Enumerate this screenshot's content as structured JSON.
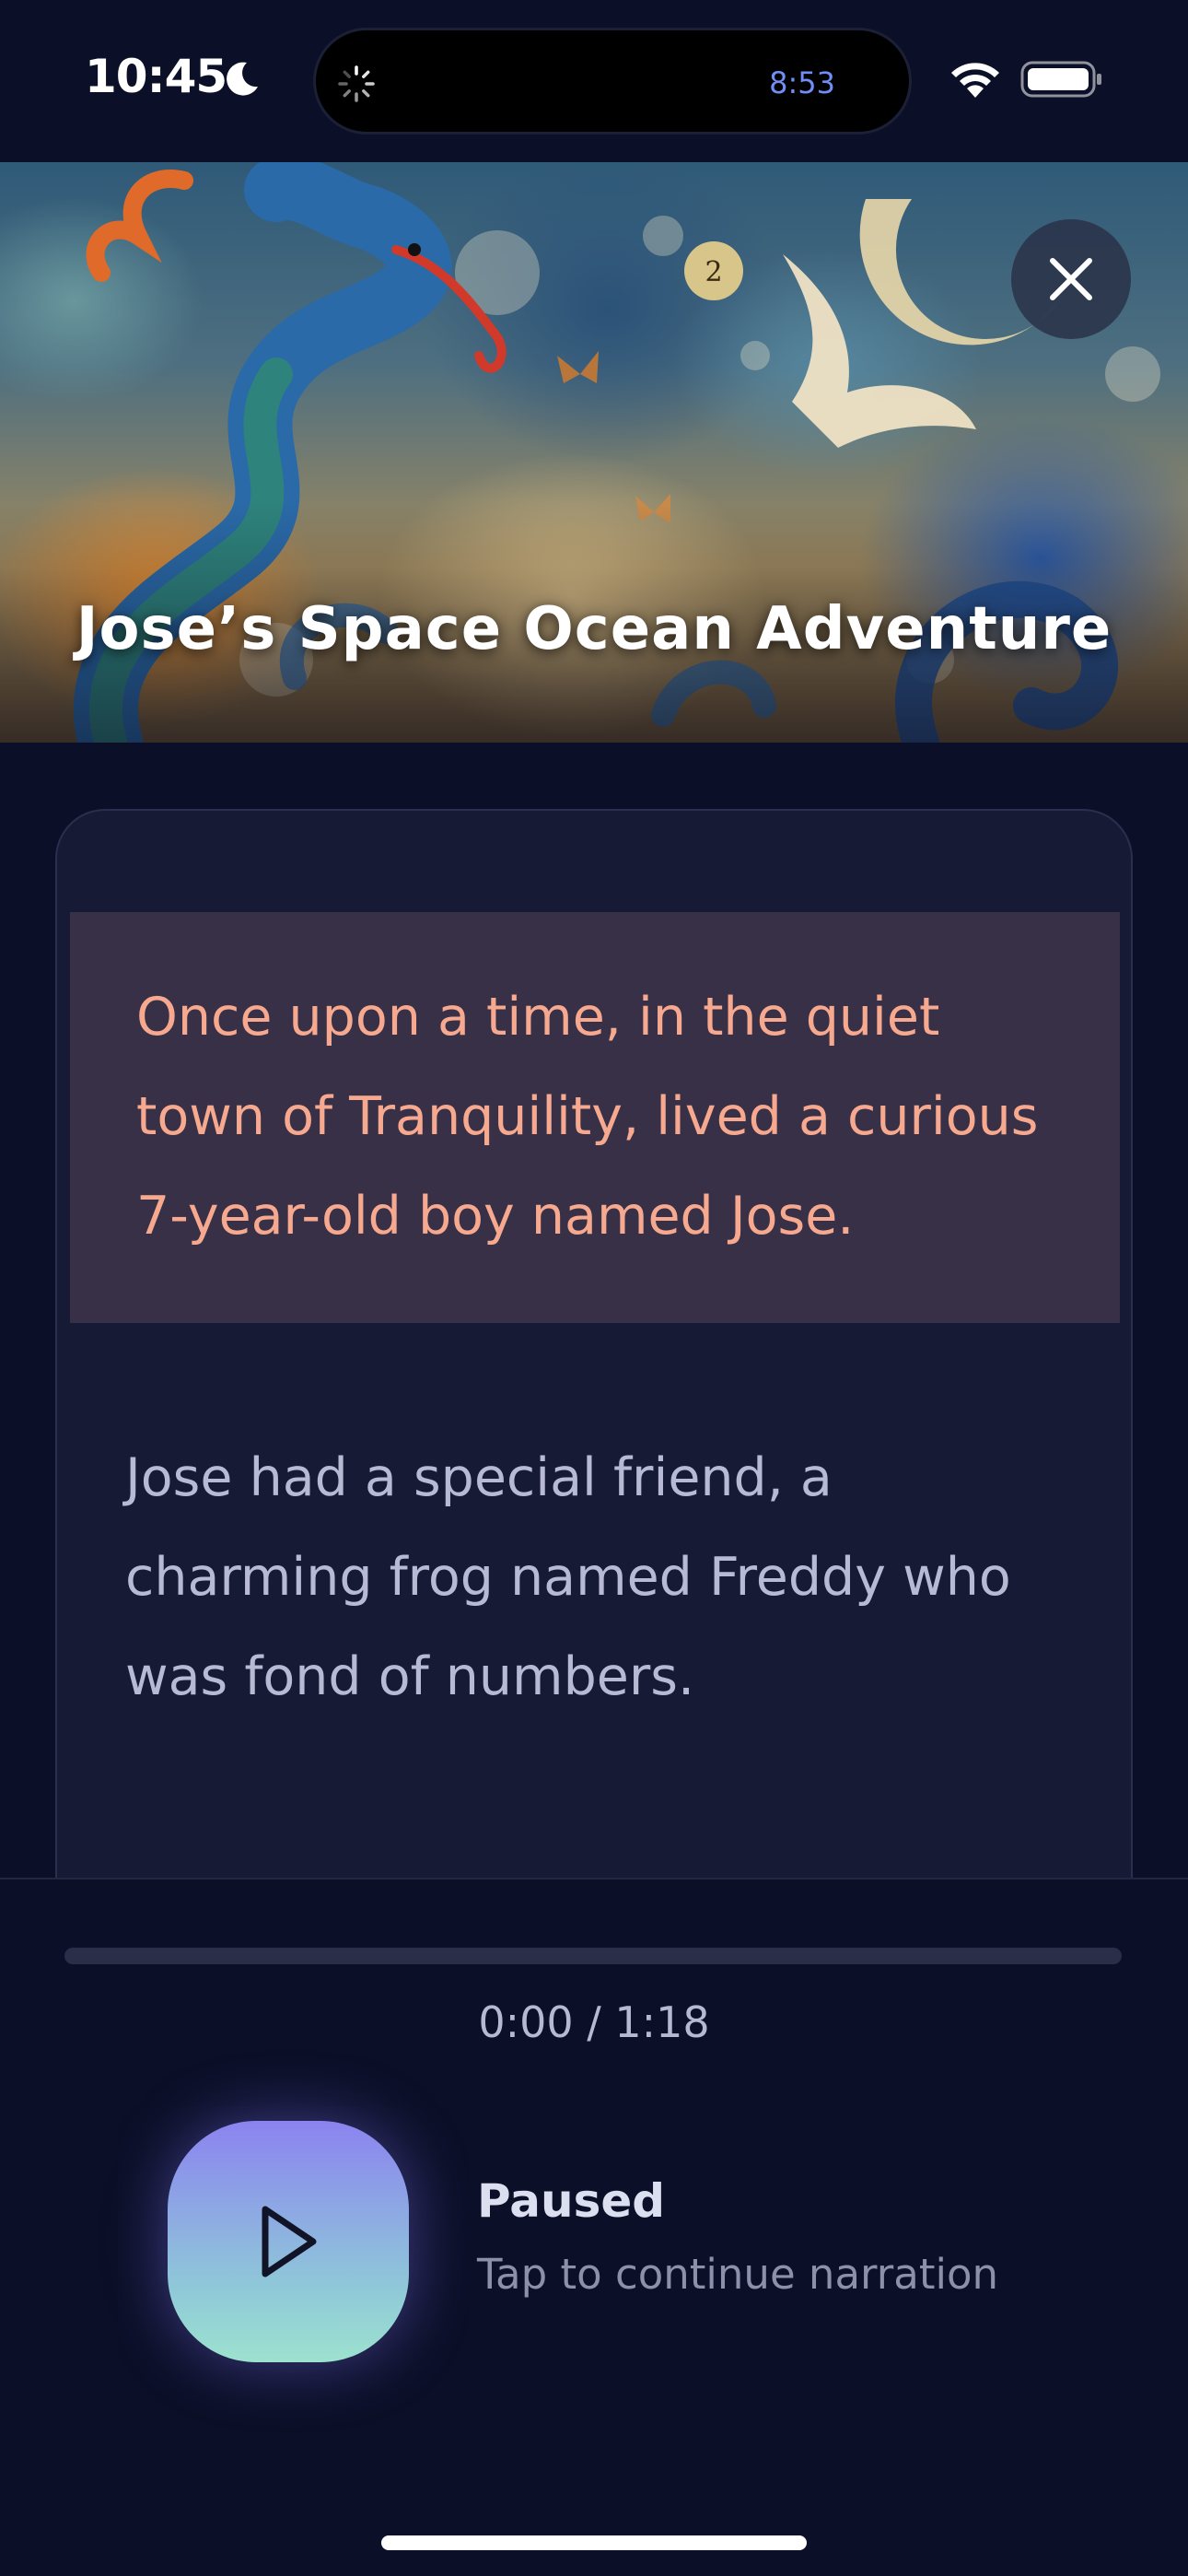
{
  "status_bar": {
    "time": "10:45",
    "island_timer": "8:53",
    "icons": [
      "moon-icon",
      "spinner-icon",
      "wifi-icon",
      "battery-icon"
    ]
  },
  "hero": {
    "title": "Jose’s Space Ocean Adventure",
    "close_icon": "close-icon"
  },
  "story": {
    "paragraphs": [
      "Once upon a time, in the quiet town of Tranquility, lived a curious 7-year-old boy named Jose.",
      "Jose had a special friend, a charming frog named Freddy who was fond of numbers."
    ],
    "active_paragraph_index": 0
  },
  "player": {
    "time_readout": "0:00 / 1:18",
    "progress_fraction": 0,
    "state_label": "Paused",
    "state_hint": "Tap to continue narration",
    "play_icon": "play-icon"
  },
  "colors": {
    "background": "#0b0f27",
    "card": "#161a35",
    "active_highlight": "#383046",
    "active_text": "#f7a98f",
    "body_text": "#b7bad2",
    "accent": "#8b83f0"
  }
}
